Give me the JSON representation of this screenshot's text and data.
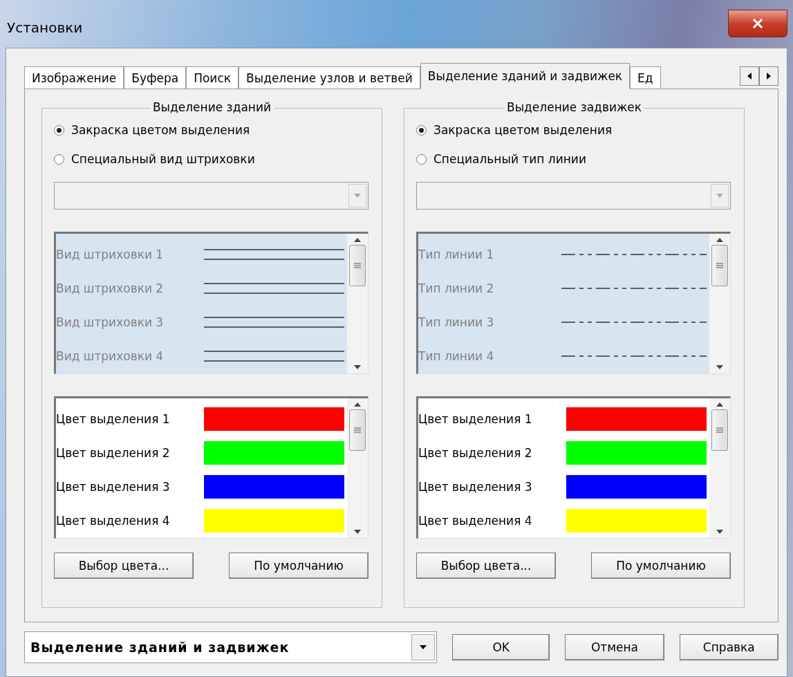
{
  "window": {
    "title": "Установки"
  },
  "tabs": [
    {
      "label": "Изображение",
      "selected": false
    },
    {
      "label": "Буфера",
      "selected": false
    },
    {
      "label": "Поиск",
      "selected": false
    },
    {
      "label": "Выделение узлов и ветвей",
      "selected": false
    },
    {
      "label": "Выделение зданий и задвижек",
      "selected": true
    },
    {
      "label": "Ед",
      "selected": false
    }
  ],
  "panels": [
    {
      "title": "Выделение зданий",
      "options": [
        {
          "label": "Закраска цветом выделения",
          "selected": true
        },
        {
          "label": "Специальный вид штриховки",
          "selected": false
        }
      ],
      "style_dropdown": {
        "disabled": true
      },
      "style_list": {
        "disabled": true,
        "items": [
          {
            "label": "Вид штриховки 1",
            "kind": "double-line"
          },
          {
            "label": "Вид штриховки 2",
            "kind": "double-line"
          },
          {
            "label": "Вид штриховки 3",
            "kind": "double-line"
          },
          {
            "label": "Вид штриховки 4",
            "kind": "double-line"
          }
        ]
      },
      "color_list": {
        "items": [
          {
            "label": "Цвет выделения 1",
            "color": "#ff0000"
          },
          {
            "label": "Цвет выделения 2",
            "color": "#00ff00"
          },
          {
            "label": "Цвет выделения 3",
            "color": "#0000ff"
          },
          {
            "label": "Цвет выделения 4",
            "color": "#ffff00"
          }
        ]
      },
      "buttons": [
        "Выбор цвета...",
        "По умолчанию"
      ]
    },
    {
      "title": "Выделение задвижек",
      "options": [
        {
          "label": "Закраска цветом выделения",
          "selected": true
        },
        {
          "label": "Специальный тип линии",
          "selected": false
        }
      ],
      "style_dropdown": {
        "disabled": true
      },
      "style_list": {
        "disabled": true,
        "items": [
          {
            "label": "Тип линии 1",
            "kind": "dash-dot"
          },
          {
            "label": "Тип линии 2",
            "kind": "dash-dot"
          },
          {
            "label": "Тип линии 3",
            "kind": "dash-dot"
          },
          {
            "label": "Тип линии 4",
            "kind": "dash-dot"
          }
        ]
      },
      "color_list": {
        "items": [
          {
            "label": "Цвет выделения 1",
            "color": "#ff0000"
          },
          {
            "label": "Цвет выделения 2",
            "color": "#00ff00"
          },
          {
            "label": "Цвет выделения 3",
            "color": "#0000ff"
          },
          {
            "label": "Цвет выделения 4",
            "color": "#ffff00"
          }
        ]
      },
      "buttons": [
        "Выбор цвета...",
        "По умолчанию"
      ]
    }
  ],
  "footer": {
    "page_select": {
      "value": "Выделение зданий и задвижек"
    },
    "buttons": [
      "OK",
      "Отмена",
      "Справка"
    ]
  }
}
